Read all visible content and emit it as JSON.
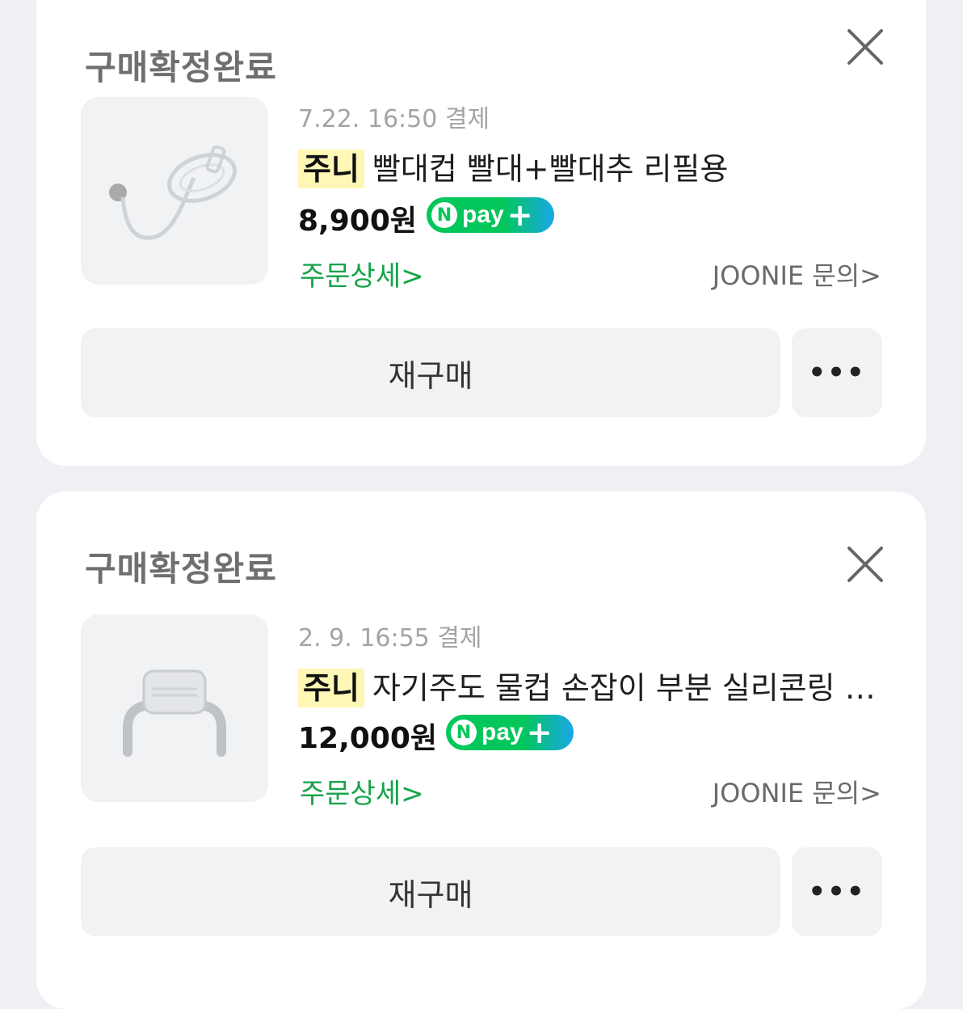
{
  "orders": [
    {
      "status": "구매확정완료",
      "date": "7.22. 16:50 결제",
      "brand": "주니",
      "product": "빨대컵 빨대+빨대추 리필용",
      "price": "8,900원",
      "npay_label": "pay",
      "detail_label": "주문상세>",
      "inquiry_label": "JOONIE 문의>",
      "rebuy_label": "재구매",
      "more_label": "•••"
    },
    {
      "status": "구매확정완료",
      "date": "2. 9. 16:55 결제",
      "brand": "주니",
      "product": "자기주도 물컵 손잡이 부분 실리콘링 …",
      "price": "12,000원",
      "npay_label": "pay",
      "detail_label": "주문상세>",
      "inquiry_label": "JOONIE 문의>",
      "rebuy_label": "재구매",
      "more_label": "•••"
    }
  ],
  "colors": {
    "accent_green": "#17a34a",
    "npay_green": "#03c75a",
    "brand_highlight": "#fff7b5"
  },
  "icons": {
    "close": "close-icon",
    "npay": "npay-badge-icon",
    "more": "more-horizontal-icon"
  }
}
